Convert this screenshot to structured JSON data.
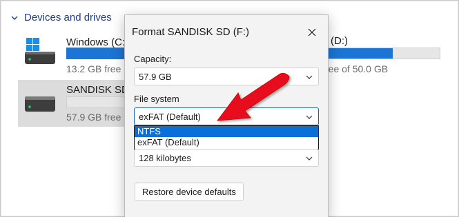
{
  "explorer": {
    "section_title": "Devices and drives",
    "drives": [
      {
        "name": "Windows (C:",
        "free": "13.2 GB free",
        "fill": 1.0
      },
      {
        "name": "SANDISK SD",
        "free": "57.9 GB free",
        "fill": 0.0
      }
    ],
    "drive_d": {
      "name": "(D:)",
      "free": "ree of 50.0 GB",
      "fill": 0.58
    }
  },
  "dialog": {
    "title": "Format SANDISK SD (F:)",
    "capacity_label": "Capacity:",
    "capacity_value": "57.9 GB",
    "filesystem_label": "File system",
    "filesystem_value": "exFAT (Default)",
    "filesystem_options": [
      "NTFS",
      "exFAT (Default)"
    ],
    "allocation_value": "128 kilobytes",
    "restore_label": "Restore device defaults"
  },
  "colors": {
    "accent": "#1c74d4",
    "selection": "#0a6fd6",
    "arrow": "#e8101a"
  }
}
